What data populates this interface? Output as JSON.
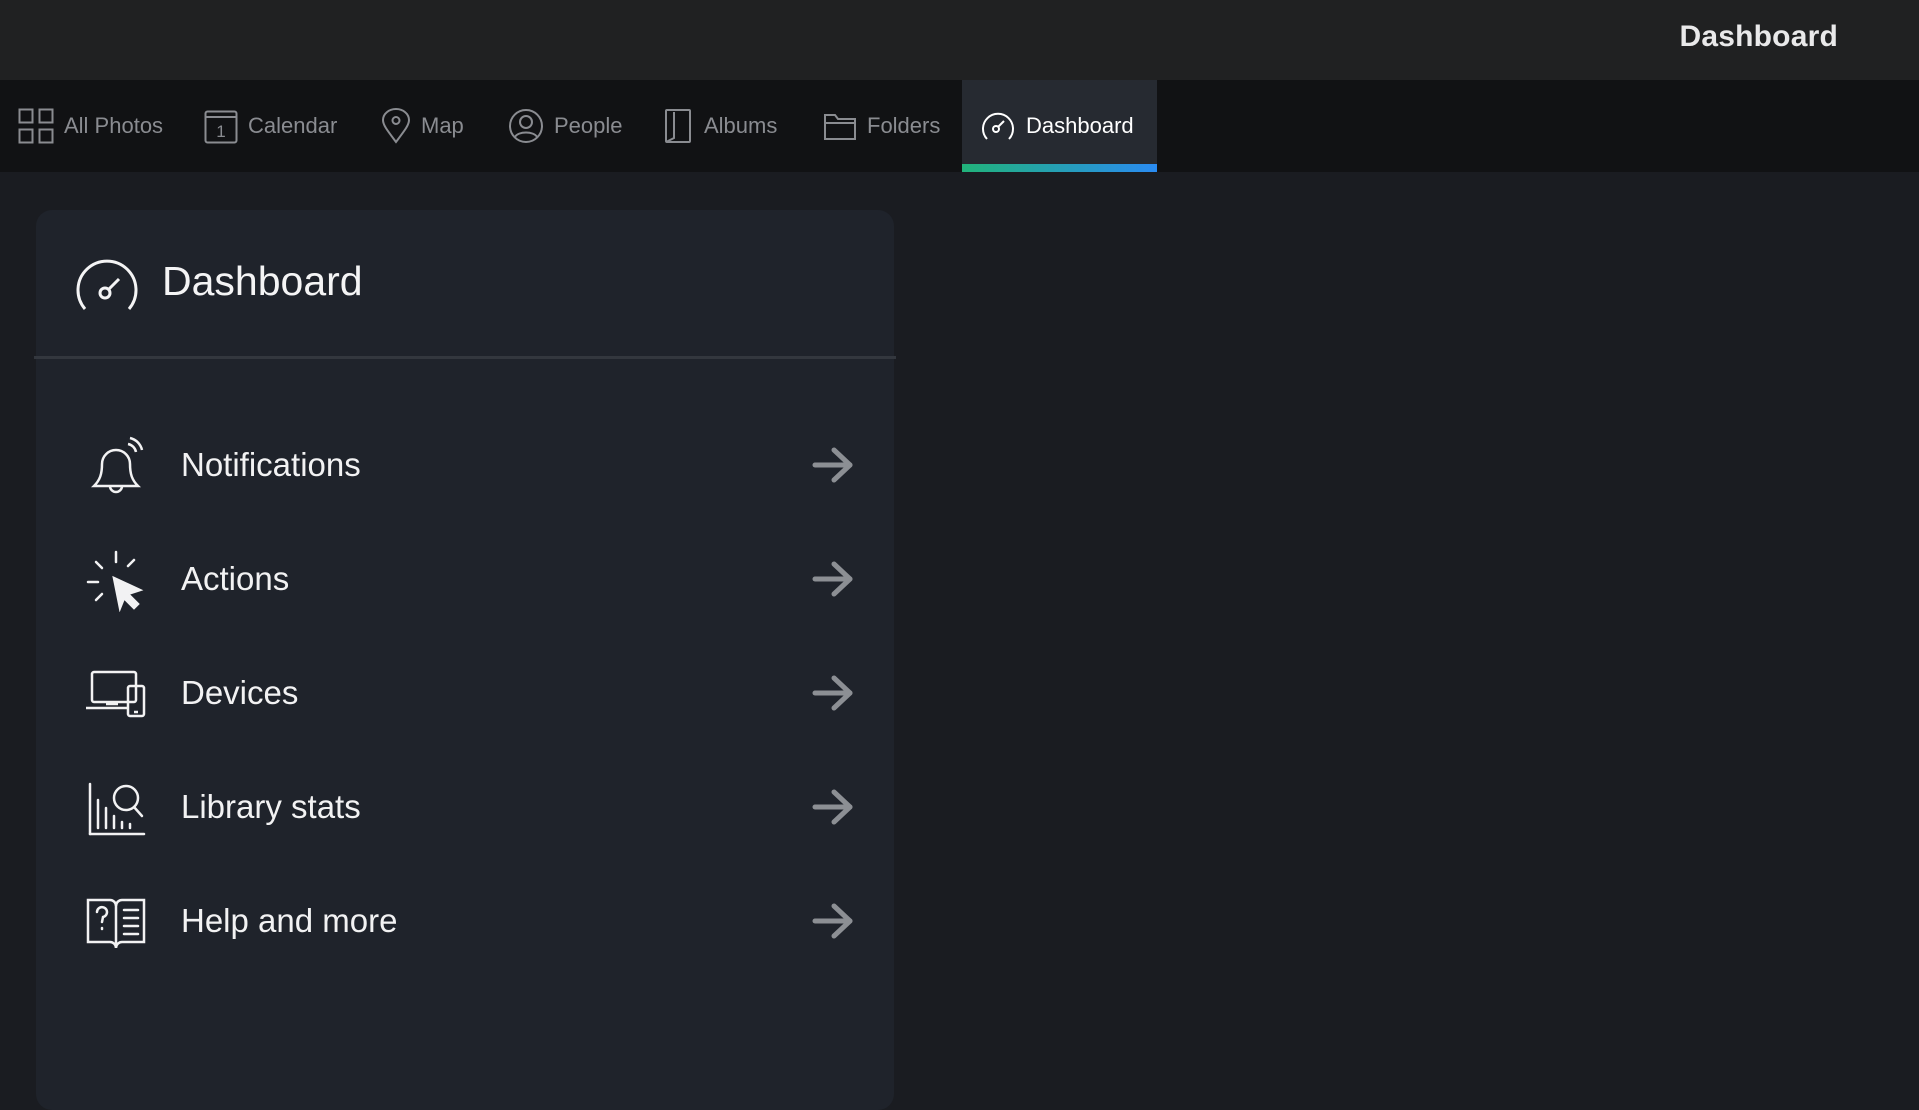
{
  "topbar": {
    "title": "Dashboard"
  },
  "tabs": [
    {
      "label": "All Photos",
      "icon": "grid-icon",
      "active": false
    },
    {
      "label": "Calendar",
      "icon": "calendar-icon",
      "active": false
    },
    {
      "label": "Map",
      "icon": "map-pin-icon",
      "active": false
    },
    {
      "label": "People",
      "icon": "person-icon",
      "active": false
    },
    {
      "label": "Albums",
      "icon": "album-icon",
      "active": false
    },
    {
      "label": "Folders",
      "icon": "folder-icon",
      "active": false
    },
    {
      "label": "Dashboard",
      "icon": "gauge-icon",
      "active": true
    }
  ],
  "calendar_icon_number": "1",
  "panel": {
    "title": "Dashboard",
    "icon": "gauge-icon",
    "items": [
      {
        "label": "Notifications",
        "icon": "bell-icon"
      },
      {
        "label": "Actions",
        "icon": "click-cursor-icon"
      },
      {
        "label": "Devices",
        "icon": "devices-icon"
      },
      {
        "label": "Library stats",
        "icon": "chart-search-icon"
      },
      {
        "label": "Help and more",
        "icon": "help-book-icon"
      }
    ]
  },
  "colors": {
    "background": "#1a1c21",
    "topbar": "#202122",
    "tabbar": "#111214",
    "active_tab": "#262a31",
    "panel": "#1f232b",
    "accent_start": "#21b37a",
    "accent_end": "#2a8bf2"
  }
}
